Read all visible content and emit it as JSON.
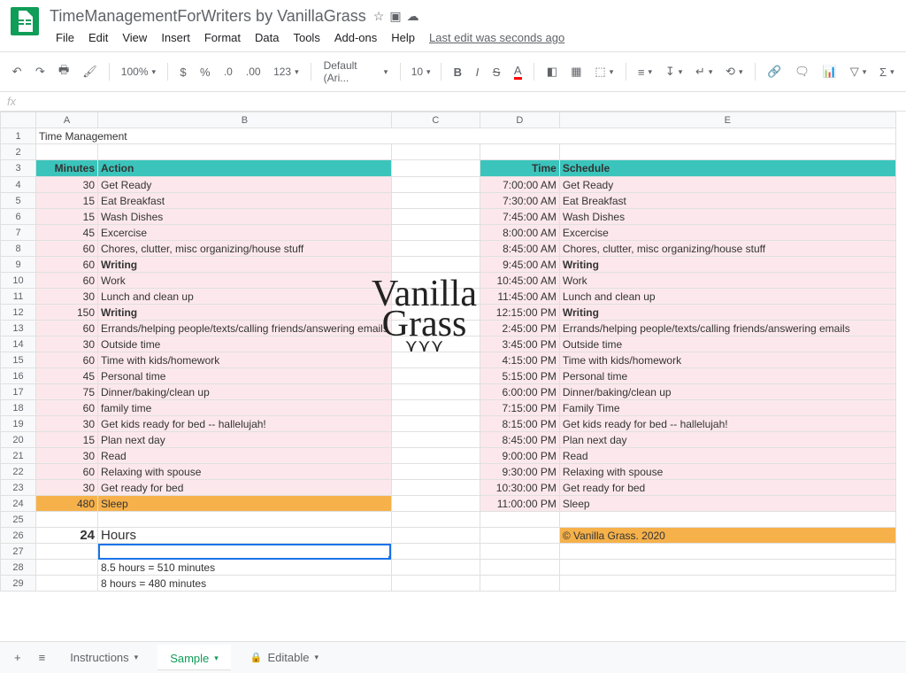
{
  "doc_title": "TimeManagementForWriters by VanillaGrass",
  "menus": [
    "File",
    "Edit",
    "View",
    "Insert",
    "Format",
    "Data",
    "Tools",
    "Add-ons",
    "Help"
  ],
  "last_edit": "Last edit was seconds ago",
  "zoom": "100%",
  "font_name": "Default (Ari...",
  "font_size": "10",
  "watermark_line1": "Vanilla",
  "watermark_line2": "Grass",
  "columns": [
    "A",
    "B",
    "C",
    "D",
    "E"
  ],
  "title_cell": "Time Management",
  "hdr_minutes": "Minutes",
  "hdr_action": "Action",
  "hdr_time": "Time",
  "hdr_schedule": "Schedule",
  "left": [
    {
      "m": "30",
      "a": "Get Ready"
    },
    {
      "m": "15",
      "a": "Eat Breakfast"
    },
    {
      "m": "15",
      "a": "Wash Dishes"
    },
    {
      "m": "45",
      "a": "Excercise"
    },
    {
      "m": "60",
      "a": "Chores, clutter, misc organizing/house stuff"
    },
    {
      "m": "60",
      "a": "Writing",
      "bold": true
    },
    {
      "m": "60",
      "a": "Work"
    },
    {
      "m": "30",
      "a": "Lunch and clean up"
    },
    {
      "m": "150",
      "a": "Writing",
      "bold": true
    },
    {
      "m": "60",
      "a": "Errands/helping people/texts/calling friends/answering emails"
    },
    {
      "m": "30",
      "a": "Outside time"
    },
    {
      "m": "60",
      "a": "Time with kids/homework"
    },
    {
      "m": "45",
      "a": "Personal time"
    },
    {
      "m": "75",
      "a": "Dinner/baking/clean up"
    },
    {
      "m": "60",
      "a": "family time"
    },
    {
      "m": "30",
      "a": "Get kids ready for bed -- hallelujah!"
    },
    {
      "m": "15",
      "a": "Plan next day"
    },
    {
      "m": "30",
      "a": "Read"
    },
    {
      "m": "60",
      "a": "Relaxing with spouse"
    },
    {
      "m": "30",
      "a": "Get ready for bed"
    },
    {
      "m": "480",
      "a": "Sleep",
      "orange": true
    }
  ],
  "right": [
    {
      "t": "7:00:00 AM",
      "s": "Get Ready"
    },
    {
      "t": "7:30:00 AM",
      "s": "Eat Breakfast"
    },
    {
      "t": "7:45:00 AM",
      "s": "Wash Dishes"
    },
    {
      "t": "8:00:00 AM",
      "s": "Excercise"
    },
    {
      "t": "8:45:00 AM",
      "s": "Chores, clutter, misc organizing/house stuff"
    },
    {
      "t": "9:45:00 AM",
      "s": "Writing",
      "bold": true
    },
    {
      "t": "10:45:00 AM",
      "s": "Work"
    },
    {
      "t": "11:45:00 AM",
      "s": "Lunch and clean up"
    },
    {
      "t": "12:15:00 PM",
      "s": "Writing",
      "bold": true
    },
    {
      "t": "2:45:00 PM",
      "s": "Errands/helping people/texts/calling friends/answering emails"
    },
    {
      "t": "3:45:00 PM",
      "s": "Outside time"
    },
    {
      "t": "4:15:00 PM",
      "s": "Time with kids/homework"
    },
    {
      "t": "5:15:00 PM",
      "s": "Personal time"
    },
    {
      "t": "6:00:00 PM",
      "s": "Dinner/baking/clean up"
    },
    {
      "t": "7:15:00 PM",
      "s": "Family Time"
    },
    {
      "t": "8:15:00 PM",
      "s": "Get kids ready for bed -- hallelujah!"
    },
    {
      "t": "8:45:00 PM",
      "s": "Plan next day"
    },
    {
      "t": "9:00:00 PM",
      "s": "Read"
    },
    {
      "t": "9:30:00 PM",
      "s": "Relaxing with spouse"
    },
    {
      "t": "10:30:00 PM",
      "s": "Get ready for bed"
    },
    {
      "t": "11:00:00 PM",
      "s": "Sleep"
    }
  ],
  "total_num": "24",
  "total_label": "Hours",
  "copyright": "© Vanilla Grass. 2020",
  "note1": "8.5 hours = 510 minutes",
  "note2": "8 hours = 480 minutes",
  "tabs": {
    "t1": "Instructions",
    "t2": "Sample",
    "t3": "Editable"
  }
}
